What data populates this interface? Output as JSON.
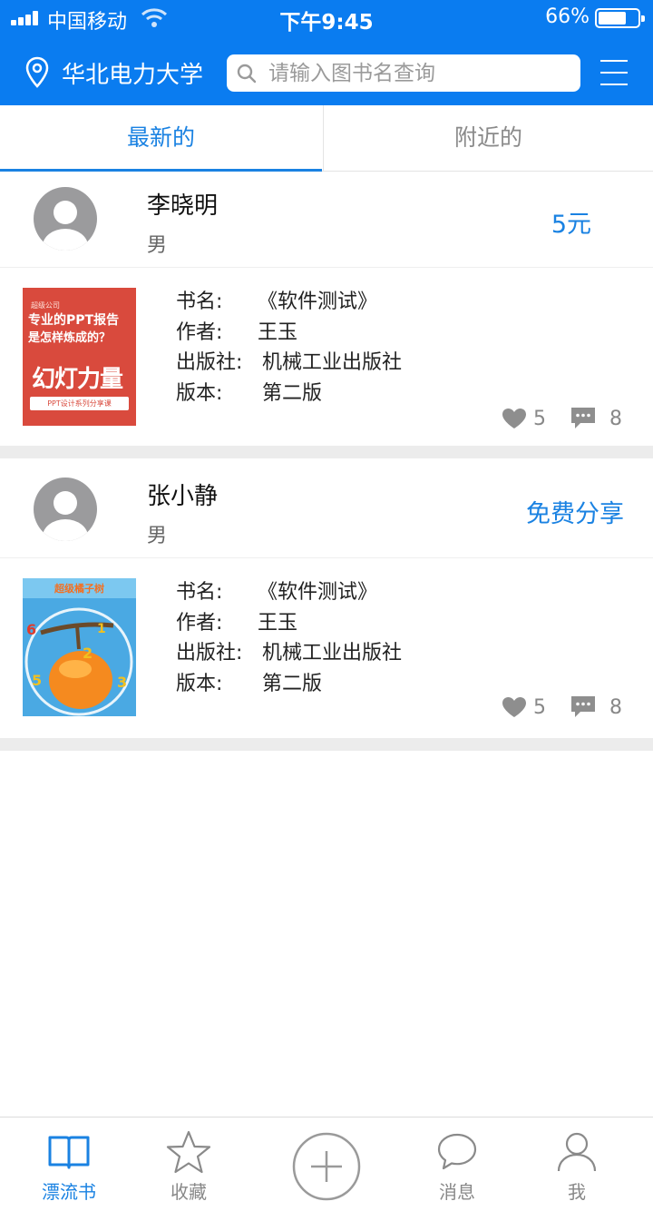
{
  "status_bar": {
    "carrier": "中国移动",
    "time": "下午9:45",
    "battery": "66%"
  },
  "header": {
    "location": "华北电力大学",
    "search_placeholder": "请输入图书名查询"
  },
  "tabs": [
    {
      "label": "最新的",
      "active": true
    },
    {
      "label": "附近的",
      "active": false
    }
  ],
  "posts": [
    {
      "user": "李晓明",
      "gender": "男",
      "price": "5元",
      "book": {
        "title_label": "书名:",
        "title": "《软件测试》",
        "author_label": "作者:",
        "author": "王玉",
        "publisher_label": "出版社:",
        "publisher": "机械工业出版社",
        "edition_label": "版本:",
        "edition": "第二版"
      },
      "likes": "5",
      "comments": "8"
    },
    {
      "user": "张小静",
      "gender": "男",
      "price": "免费分享",
      "book": {
        "title_label": "书名:",
        "title": "《软件测试》",
        "author_label": "作者:",
        "author": "王玉",
        "publisher_label": "出版社:",
        "publisher": "机械工业出版社",
        "edition_label": "版本:",
        "edition": "第二版"
      },
      "likes": "5",
      "comments": "8"
    }
  ],
  "covers": {
    "first": {
      "line1": "超级公司",
      "line2": "专业的PPT报告",
      "line3": "是怎样炼成的？",
      "line4": "幻灯力量",
      "line5": "PPT设计系列分享课"
    },
    "second": {
      "title": "超级橘子树"
    }
  },
  "bottom_nav": [
    {
      "label": "漂流书",
      "icon": "book-icon",
      "active": true
    },
    {
      "label": "收藏",
      "icon": "star-icon",
      "active": false
    },
    {
      "label": "",
      "icon": "add-icon",
      "active": false
    },
    {
      "label": "消息",
      "icon": "message-icon",
      "active": false
    },
    {
      "label": "我",
      "icon": "profile-icon",
      "active": false
    }
  ],
  "colors": {
    "primary": "#0a7cf0",
    "accent_text": "#1a82e2",
    "divider": "#ececec",
    "muted": "#888888"
  }
}
